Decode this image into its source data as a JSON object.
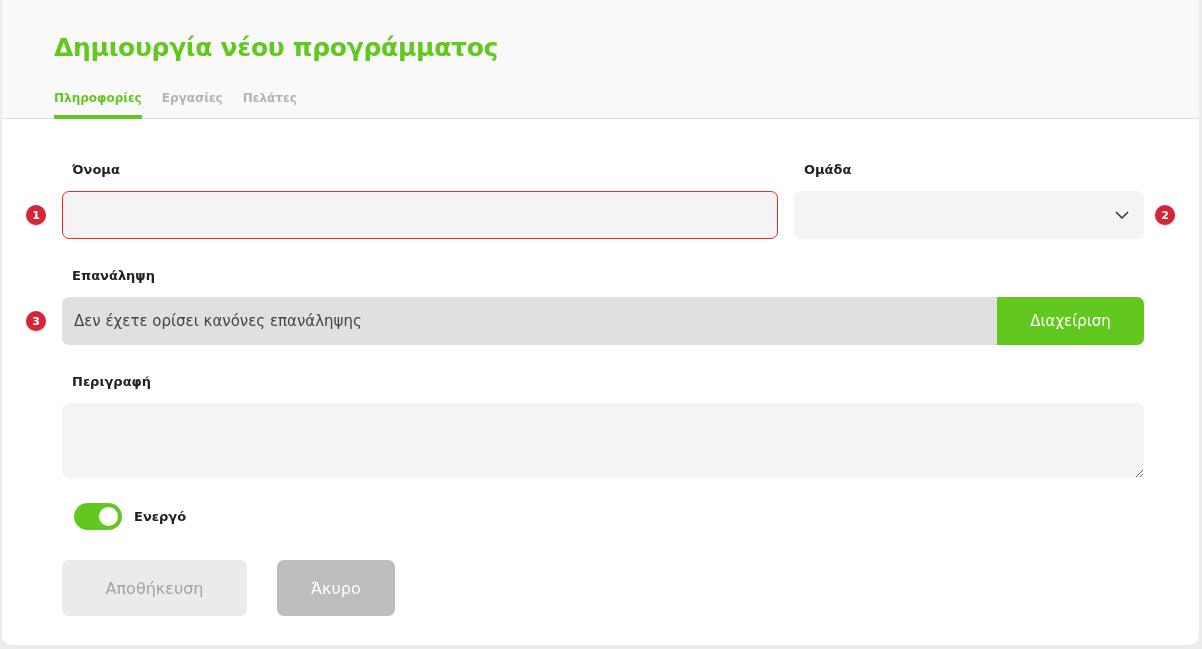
{
  "title": "Δημιουργία νέου προγράμματος",
  "tabs": [
    {
      "label": "Πληροφορίες",
      "selected": true
    },
    {
      "label": "Εργασίες",
      "selected": false
    },
    {
      "label": "Πελάτες",
      "selected": false
    }
  ],
  "fields": [
    {
      "kind": "text",
      "label": "Όνομα",
      "badge": "1",
      "error": true
    },
    {
      "kind": "select",
      "label": "Ομάδα",
      "badge": "2",
      "error": false
    },
    {
      "kind": "rule",
      "label": "Επανάληψη",
      "badge": "3",
      "value": "Δεν έχετε ορίσει κανόνες επανάληψης",
      "button": "Διαχείριση"
    },
    {
      "kind": "textarea",
      "label": "Περιγραφή"
    }
  ],
  "toggle": {
    "label": "Ενεργό",
    "on": true
  },
  "buttons": [
    {
      "label": "Αποθήκευση",
      "disabled": true
    },
    {
      "label": "Άκυρο",
      "disabled": false
    }
  ]
}
